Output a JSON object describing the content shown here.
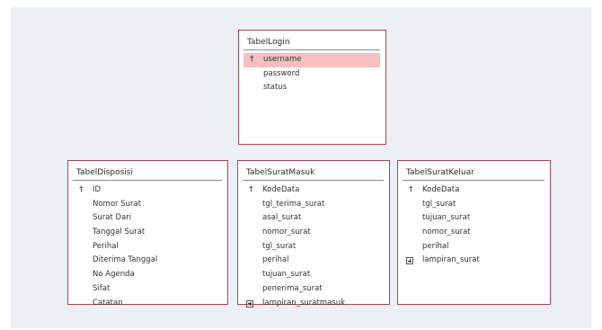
{
  "tables": [
    {
      "title": "TabelLogin",
      "fields": [
        {
          "name": "username",
          "key": true,
          "selected": true
        },
        {
          "name": "password"
        },
        {
          "name": "status"
        }
      ]
    },
    {
      "title": "TabelDisposisi",
      "fields": [
        {
          "name": "ID",
          "key": true
        },
        {
          "name": "Nomor Surat"
        },
        {
          "name": "Surat Dari"
        },
        {
          "name": "Tanggal Surat"
        },
        {
          "name": "Perihal"
        },
        {
          "name": "Diterima Tanggal"
        },
        {
          "name": "No Agenda"
        },
        {
          "name": "Sifat"
        },
        {
          "name": "Catatan"
        }
      ]
    },
    {
      "title": "TabelSuratMasuk",
      "fields": [
        {
          "name": "KodeData",
          "key": true
        },
        {
          "name": "tgl_terima_surat"
        },
        {
          "name": "asal_surat"
        },
        {
          "name": "nomor_surat"
        },
        {
          "name": "tgl_surat"
        },
        {
          "name": "perihal"
        },
        {
          "name": "tujuan_surat"
        },
        {
          "name": "penerima_surat"
        },
        {
          "name": "lampiran_suratmasuk",
          "expandable": true
        }
      ]
    },
    {
      "title": "TabelSuratKeluar",
      "fields": [
        {
          "name": "KodeData",
          "key": true
        },
        {
          "name": "tgl_surat"
        },
        {
          "name": "tujuan_surat"
        },
        {
          "name": "nomor_surat"
        },
        {
          "name": "perihal"
        },
        {
          "name": "lampiran_surat",
          "expandable": true
        }
      ]
    }
  ],
  "icons": {
    "key": "primary-key-icon",
    "expand": "expand-plus-icon"
  },
  "colors": {
    "border": "#a84455",
    "selection": "#f4c0c1",
    "canvas": "#eceff4"
  }
}
